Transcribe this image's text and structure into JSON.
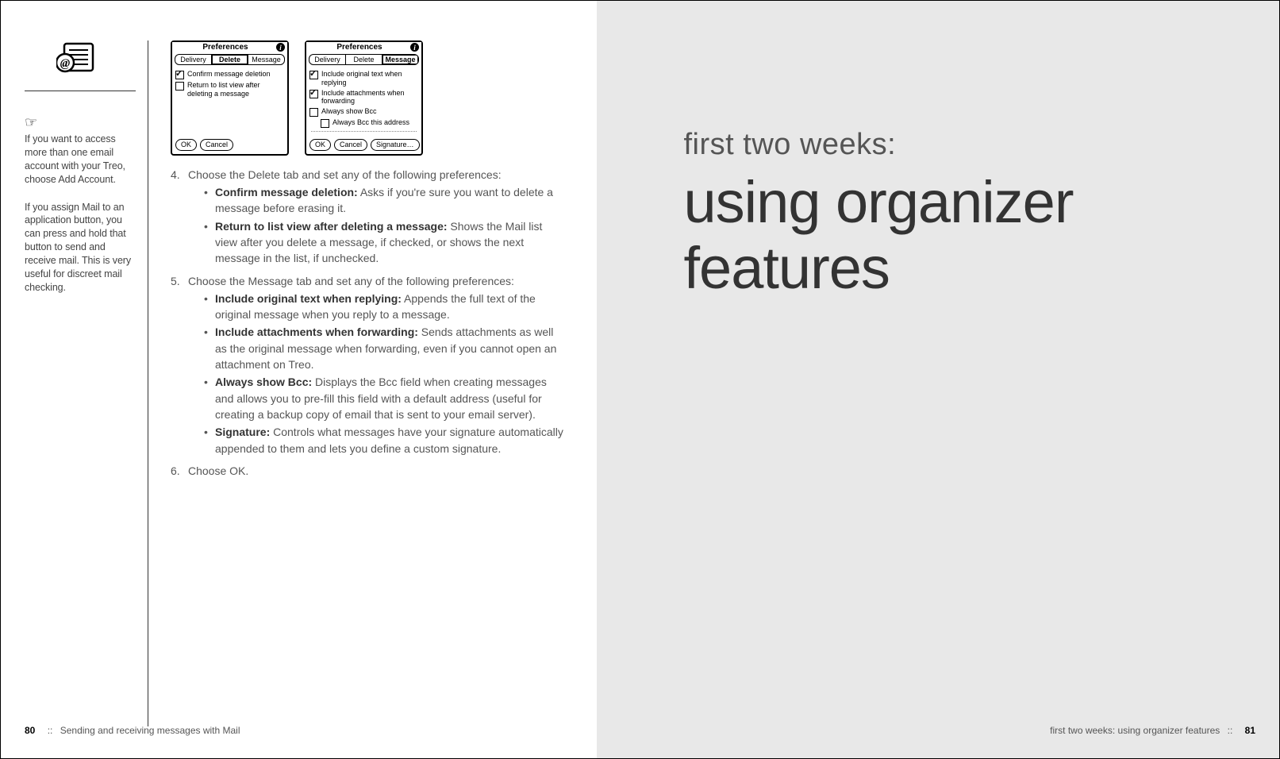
{
  "sidebar": {
    "tip1": "If you want to access more than one email account with your Treo, choose Add Account.",
    "tip2": "If you assign Mail to an application button, you can press and hold that button to send and receive mail. This is very useful for discreet mail checking."
  },
  "dialog1": {
    "title": "Preferences",
    "tabs": [
      "Delivery",
      "Delete",
      "Message"
    ],
    "active": 1,
    "options": [
      {
        "checked": true,
        "label": "Confirm message deletion"
      },
      {
        "checked": false,
        "label": "Return to list view after deleting a message"
      }
    ],
    "buttons": [
      "OK",
      "Cancel"
    ]
  },
  "dialog2": {
    "title": "Preferences",
    "tabs": [
      "Delivery",
      "Delete",
      "Message"
    ],
    "active": 2,
    "options": [
      {
        "checked": true,
        "label": "Include original text when replying"
      },
      {
        "checked": true,
        "label": "Include attachments when forwarding"
      },
      {
        "checked": false,
        "label": "Always show Bcc"
      },
      {
        "checked": false,
        "label": "Always Bcc this address",
        "indent": true
      }
    ],
    "buttons": [
      "OK",
      "Cancel",
      "Signature…"
    ]
  },
  "steps": {
    "s4": {
      "num": "4.",
      "intro": "Choose the Delete tab and set any of the following preferences:",
      "bullets": [
        {
          "term": "Confirm message deletion:",
          "rest": " Asks if you're sure you want to delete a message before erasing it."
        },
        {
          "term": "Return to list view after deleting a message:",
          "rest": " Shows the Mail list view after you delete a message, if checked, or shows the next message in the list, if unchecked."
        }
      ]
    },
    "s5": {
      "num": "5.",
      "intro": "Choose the Message tab and set any of the following preferences:",
      "bullets": [
        {
          "term": "Include original text when replying:",
          "rest": " Appends the full text of the original message when you reply to a message."
        },
        {
          "term": "Include attachments when forwarding:",
          "rest": " Sends attachments as well as the original message when forwarding, even if you cannot open an attachment on Treo."
        },
        {
          "term": "Always show Bcc:",
          "rest": " Displays the Bcc field when creating messages and allows you to pre-fill this field with a default address (useful for creating a backup copy of email that is sent to your email server)."
        },
        {
          "term": "Signature:",
          "rest": " Controls what messages have your signature automatically appended to them and lets you define a custom signature."
        }
      ]
    },
    "s6": {
      "num": "6.",
      "intro": "Choose OK."
    }
  },
  "footerLeft": {
    "page": "80",
    "sep": "::",
    "text": "Sending and receiving messages with Mail"
  },
  "footerRight": {
    "text": "first two weeks: using organizer features",
    "sep": "::",
    "page": "81"
  },
  "rightPage": {
    "eyebrow": "first two weeks:",
    "title": "using organizer features"
  }
}
